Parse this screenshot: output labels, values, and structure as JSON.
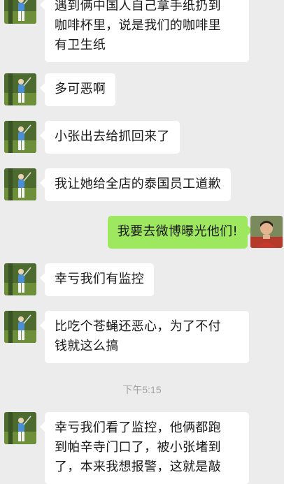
{
  "messages": [
    {
      "direction": "in",
      "text": "遇到俩中国人自己拿手纸扔到\n咖啡杯里，说是我们的咖啡里\n有卫生纸"
    },
    {
      "direction": "in",
      "text": "多可恶啊"
    },
    {
      "direction": "in",
      "text": "小张出去给抓回来了"
    },
    {
      "direction": "in",
      "text": "我让她给全店的泰国员工道歉"
    },
    {
      "direction": "out",
      "text": "我要去微博曝光他们!"
    },
    {
      "direction": "in",
      "text": "幸亏我们有监控"
    },
    {
      "direction": "in",
      "text": "比吃个苍蝇还恶心，为了不付\n钱就这么搞"
    },
    {
      "direction": "in",
      "text": "幸亏我们看了监控，他俩都跑\n到帕辛寺门口了，被小张堵到\n了，本来我想报警，这就是敲"
    }
  ],
  "timestamp": "下午5:15",
  "colors": {
    "background": "#ececec",
    "incoming_bubble": "#ffffff",
    "outgoing_bubble": "#9ee85f",
    "timestamp_text": "#a3a3a3"
  },
  "icons": {
    "contact_avatar": "golfer-photo-avatar",
    "self_avatar": "person-photo-avatar"
  }
}
